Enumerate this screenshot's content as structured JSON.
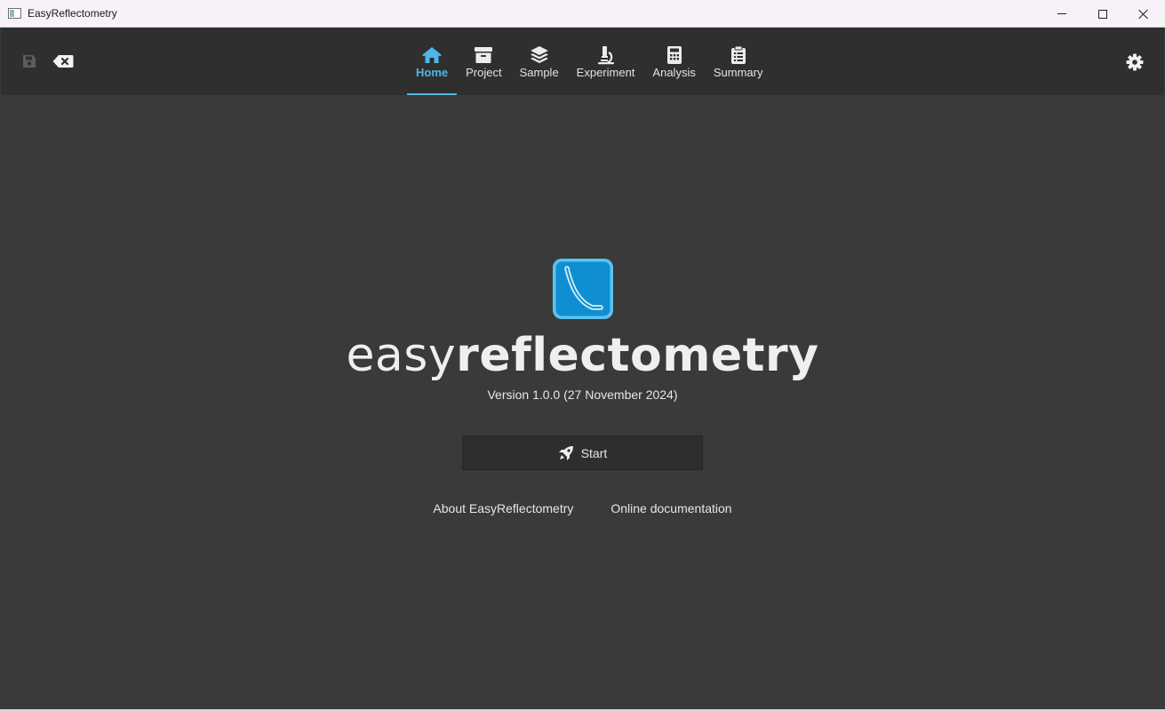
{
  "window": {
    "title": "EasyReflectometry"
  },
  "toolbar": {
    "save_icon": "save-icon",
    "reset_icon": "backspace-icon",
    "settings_icon": "gear-icon",
    "tabs": [
      {
        "label": "Home",
        "icon": "home-icon",
        "active": true
      },
      {
        "label": "Project",
        "icon": "archive-icon",
        "active": false
      },
      {
        "label": "Sample",
        "icon": "layers-icon",
        "active": false
      },
      {
        "label": "Experiment",
        "icon": "microscope-icon",
        "active": false
      },
      {
        "label": "Analysis",
        "icon": "calculator-icon",
        "active": false
      },
      {
        "label": "Summary",
        "icon": "clipboard-icon",
        "active": false
      }
    ],
    "accent_color": "#4fb6e6"
  },
  "home": {
    "brand_light": "easy",
    "brand_bold": "reflectometry",
    "version": "Version 1.0.0 (27 November 2024)",
    "start_label": "Start",
    "start_icon": "rocket-icon",
    "about_link": "About EasyReflectometry",
    "docs_link": "Online documentation"
  },
  "colors": {
    "background": "#3a3a3a",
    "toolbar_bg": "#2f2f2f",
    "logo_blue": "#0f8fd2"
  }
}
